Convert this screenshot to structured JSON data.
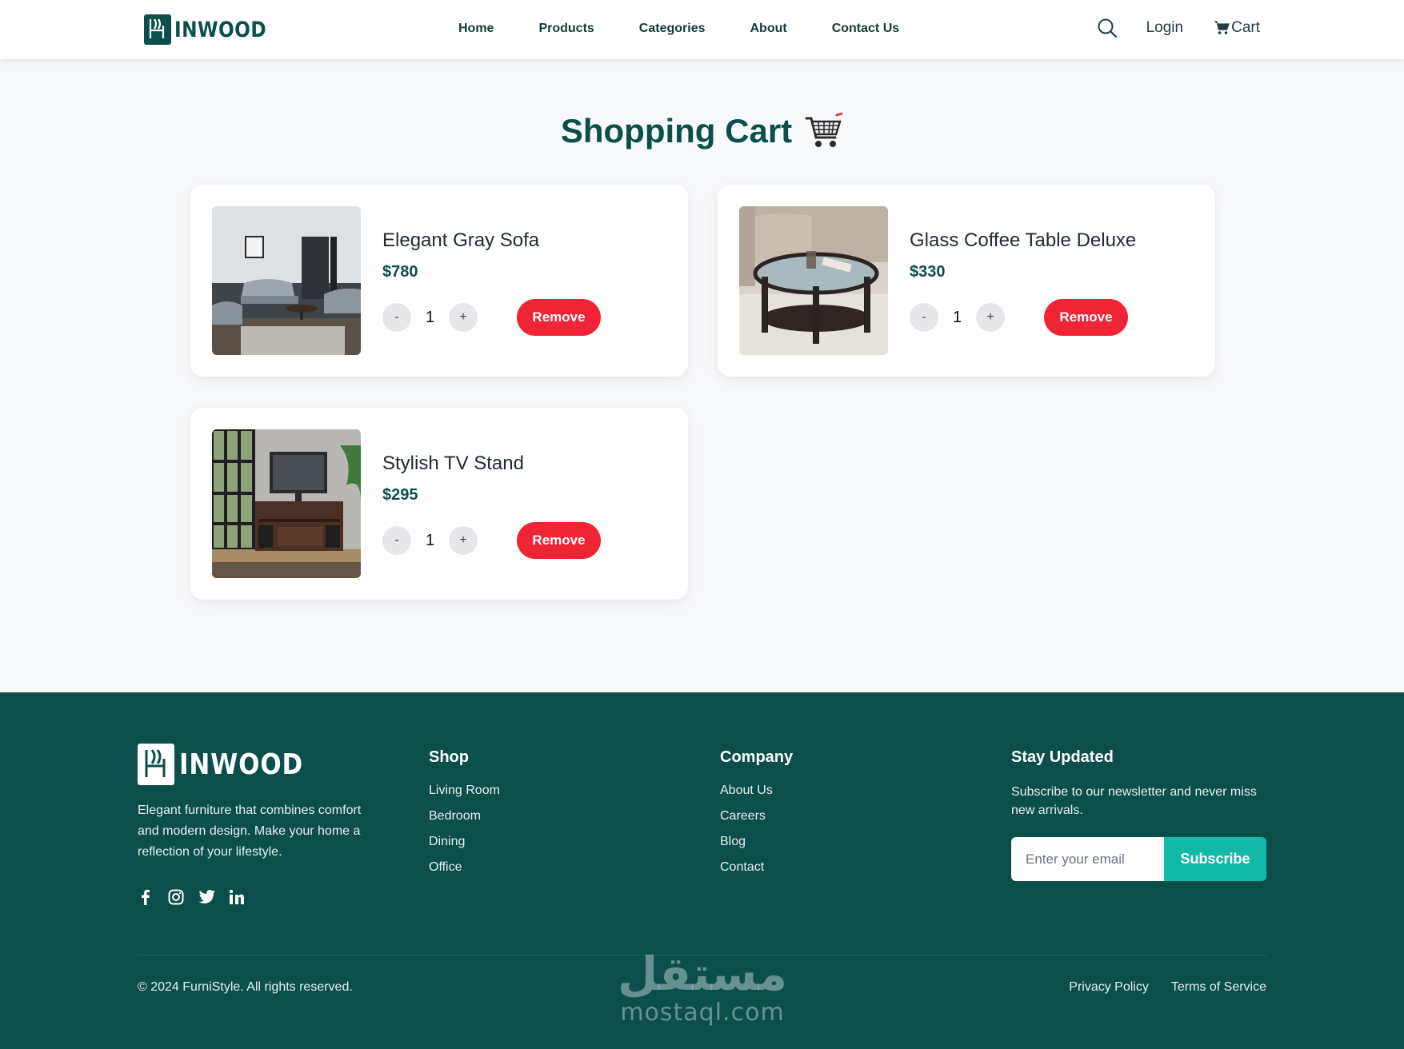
{
  "header": {
    "brand": "INWOOD",
    "nav": [
      "Home",
      "Products",
      "Categories",
      "About",
      "Contact Us"
    ],
    "login": "Login",
    "cart": "Cart"
  },
  "main": {
    "title": "Shopping Cart",
    "items": [
      {
        "name": "Elegant Gray Sofa",
        "price": "$780",
        "qty": "1",
        "remove": "Remove"
      },
      {
        "name": "Glass Coffee Table Deluxe",
        "price": "$330",
        "qty": "1",
        "remove": "Remove"
      },
      {
        "name": "Stylish TV Stand",
        "price": "$295",
        "qty": "1",
        "remove": "Remove"
      }
    ],
    "minus": "-",
    "plus": "+"
  },
  "footer": {
    "brand": "INWOOD",
    "description": "Elegant furniture that combines comfort and modern design. Make your home a reflection of your lifestyle.",
    "shop": {
      "title": "Shop",
      "links": [
        "Living Room",
        "Bedroom",
        "Dining",
        "Office"
      ]
    },
    "company": {
      "title": "Company",
      "links": [
        "About Us",
        "Careers",
        "Blog",
        "Contact"
      ]
    },
    "newsletter": {
      "title": "Stay Updated",
      "text": "Subscribe to our newsletter and never miss new arrivals.",
      "placeholder": "Enter your email",
      "button": "Subscribe"
    },
    "copyright": "© 2024 FurniStyle. All rights reserved.",
    "legal": [
      "Privacy Policy",
      "Terms of Service"
    ],
    "watermark_ar": "مستقل",
    "watermark": "mostaql.com"
  },
  "colors": {
    "brand": "#0b4f4a",
    "danger": "#ef2434",
    "accent": "#14b8a6"
  }
}
